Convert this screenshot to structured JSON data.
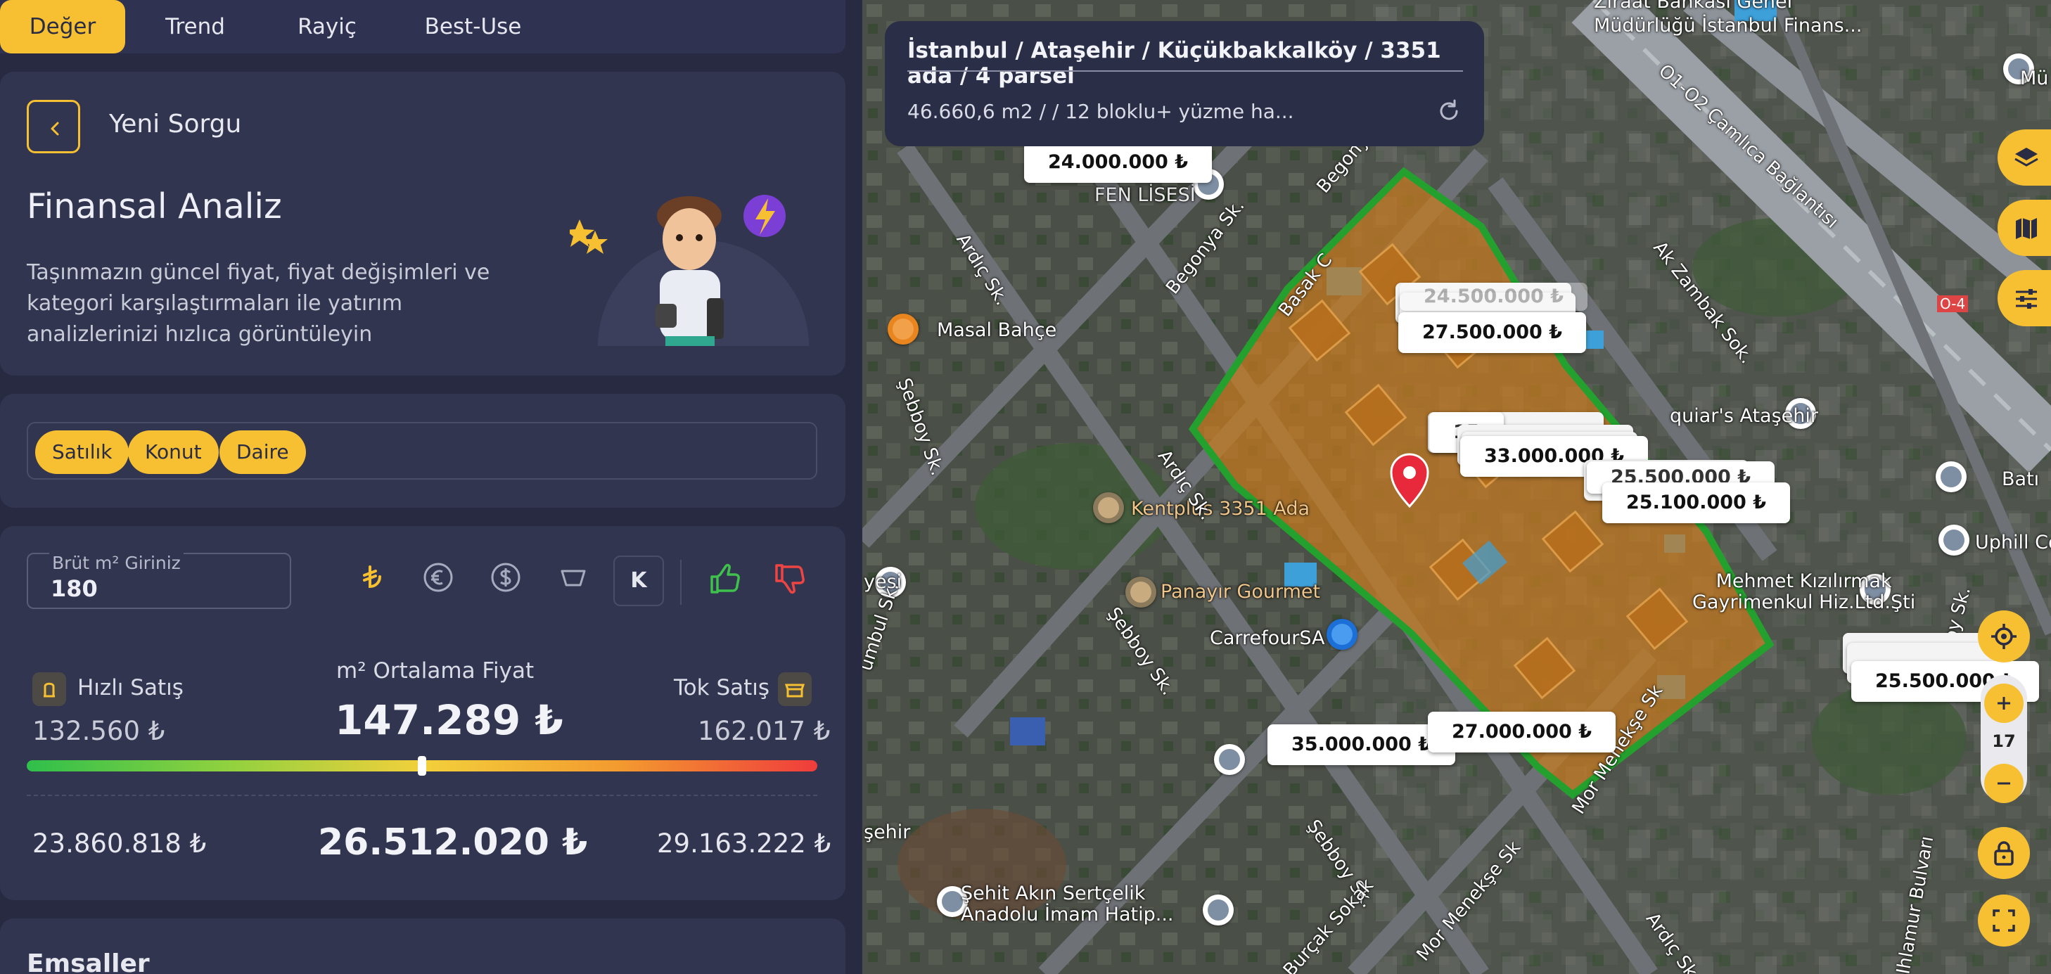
{
  "tabs": [
    "Değer",
    "Trend",
    "Rayiç",
    "Best-Use"
  ],
  "header": {
    "back_label": "Yeni Sorgu"
  },
  "intro": {
    "title": "Finansal Analiz",
    "description": "Taşınmazın güncel fiyat, fiyat değişimleri ve kategori karşılaştırmaları ile yatırım analizlerinizi hızlıca görüntüleyin"
  },
  "filters": [
    "Satılık",
    "Konut",
    "Daire"
  ],
  "input": {
    "label": "Brüt m² Giriniz",
    "value": "180"
  },
  "currency_icons": [
    "lira-icon",
    "euro-icon",
    "dollar-icon",
    "gold-icon"
  ],
  "k_button": "K",
  "stats": {
    "fast_label": "Hızlı Satış",
    "fast_value": "132.560 ₺",
    "avg_label": "m² Ortalama Fiyat",
    "avg_value": "147.289 ₺",
    "slow_label": "Tok Satış",
    "slow_value": "162.017 ₺",
    "gauge_position": 0.5,
    "total_fast": "23.860.818 ₺",
    "total_avg": "26.512.020 ₺",
    "total_slow": "29.163.222 ₺"
  },
  "section_next": "Emsaller",
  "map": {
    "info_title": "İstanbul / Ataşehir / Küçükbakkalköy / 3351 ada / 4 parsel",
    "info_sub": "46.660,6 m2  /     /  12 bloklu+ yüzme ha...",
    "zoom": "17",
    "prices": [
      "24.000.000 ₺",
      "27.500.000 ₺",
      "33.000.000 ₺",
      "25.500.000 ₺",
      "25.100.000 ₺",
      "25.500.000 ₺",
      "35.000.000 ₺",
      "27.000.000 ₺"
    ],
    "partial_prices": [
      "24.500.000 ₺",
      "15"
    ],
    "places": {
      "fen_lisesi": "FEN LİSESİ",
      "masal": "Masal Bahçe",
      "kentplus": "Kentplus 3351 Ada",
      "panayir": "Panayır Gourmet",
      "carrefour": "CarrefourSA",
      "aquiars": "quiar's Ataşehir",
      "mehmet": "Mehmet Kızılırmak\nGayrimenkul Hiz.Ltd.Şti",
      "uphill": "Uphill Cou",
      "bati": "Batı",
      "sehit": "Şehit Akın Sertçelik\nAnadolu İmam Hatip...",
      "ziraat": "Ziraat Bankası Genel\nMüdürlüğü İstanbul Finans...",
      "yesi": "yesi",
      "sehir": "şehir",
      "mu": "Mü"
    },
    "roads": {
      "r1": "Begonya Sk.",
      "r2": "Begonya Sk.",
      "r3": "Ardıç Sk.",
      "r4": "Ardıç Sk.",
      "r5": "Şebboy Sk.",
      "r6": "Şebboy Sk.",
      "r7": "Şebboy Sk.",
      "r8": "Ak Zambak Sok.",
      "r9": "O1-O2 Çamlıca Bağlantısı",
      "r10": "Mor Menekşe Sk",
      "r11": "Mor Menekşe Sk",
      "r12": "Burçak Sokak",
      "r13": "Ardıç Sk.",
      "r14": "Ihlamur Bulvarı",
      "r15": "Şebboy Sk.",
      "r16": "Basak C",
      "r17": "umbul Sk.",
      "r18": "O-4"
    }
  }
}
